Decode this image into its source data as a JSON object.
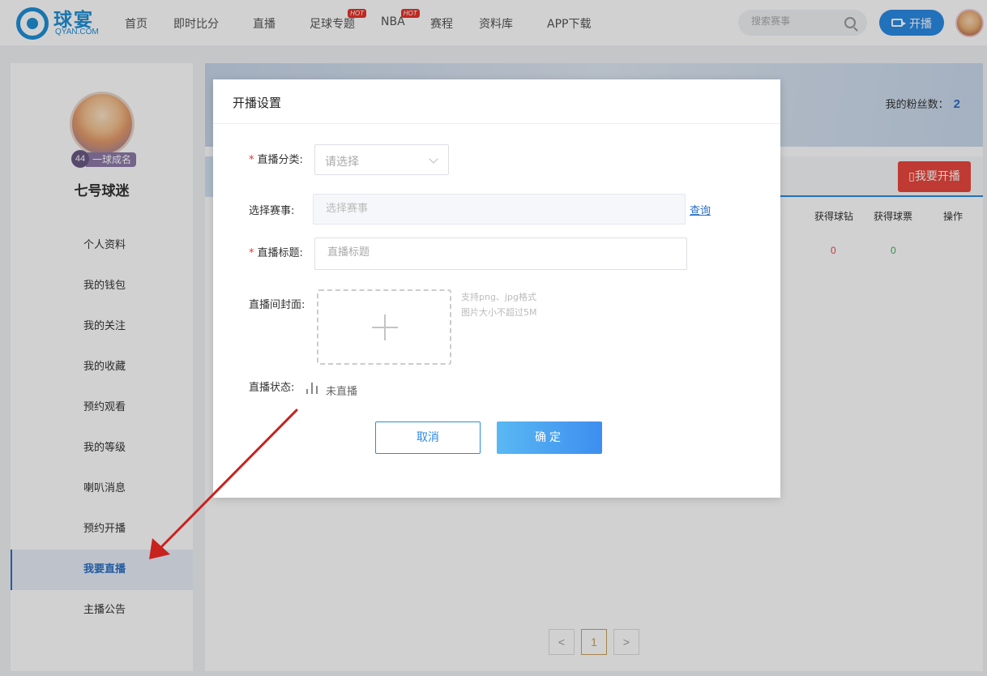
{
  "header": {
    "logo_text": "球宴",
    "logo_sub": "QYAN.COM",
    "nav": [
      {
        "label": "首页",
        "hot": ""
      },
      {
        "label": "即时比分",
        "hot": ""
      },
      {
        "label": "直播",
        "hot": ""
      },
      {
        "label": "足球专题",
        "hot": "HOT"
      },
      {
        "label": "NBA",
        "hot": "HOT"
      },
      {
        "label": "赛程",
        "hot": ""
      },
      {
        "label": "资料库",
        "hot": ""
      },
      {
        "label": "APP下载",
        "hot": ""
      }
    ],
    "search_placeholder": "搜索赛事",
    "live_button": "开播"
  },
  "sidebar": {
    "level_num": "44",
    "level_title": "一球成名",
    "username": "七号球迷",
    "menu": [
      {
        "label": "个人资料"
      },
      {
        "label": "我的钱包"
      },
      {
        "label": "我的关注"
      },
      {
        "label": "我的收藏"
      },
      {
        "label": "预约观看"
      },
      {
        "label": "我的等级"
      },
      {
        "label": "喇叭消息"
      },
      {
        "label": "预约开播"
      },
      {
        "label": "我要直播",
        "active": true
      },
      {
        "label": "主播公告"
      }
    ]
  },
  "main": {
    "fans_label": "我的粉丝数：",
    "fans_count": "2",
    "open_live_button": "▯我要开播",
    "columns": [
      "获得球钻",
      "获得球票",
      "操作"
    ],
    "row": {
      "diamonds": "0",
      "tickets": "0"
    },
    "pager": {
      "prev": "<",
      "current": "1",
      "next": ">"
    }
  },
  "modal": {
    "title": "开播设置",
    "category_label": "直播分类:",
    "category_placeholder": "请选择",
    "match_label": "选择赛事:",
    "match_placeholder": "选择赛事",
    "query_link": "查询",
    "title_label": "直播标题:",
    "title_placeholder": "直播标题",
    "cover_label": "直播间封面:",
    "cover_hint_1": "支持png、jpg格式",
    "cover_hint_2": "图片大小不超过5M",
    "status_label": "直播状态:",
    "status_value": "未直播",
    "cancel_button": "取消",
    "ok_button": "确定",
    "required_mark": "*"
  },
  "colors": {
    "accent": "#2a8ae5",
    "danger": "#e8473e",
    "arrow": "#c8221e"
  }
}
